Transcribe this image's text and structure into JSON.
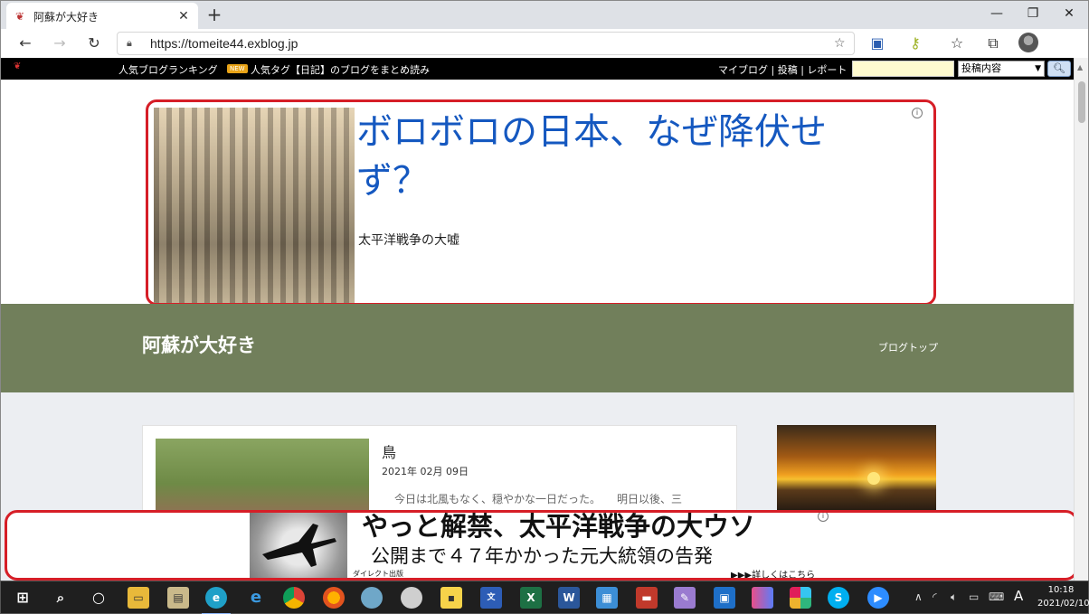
{
  "browser": {
    "tab_title": "阿蘇が大好き",
    "url": "https://tomeite44.exblog.jp"
  },
  "blogbar": {
    "ranking": "人気ブログランキング",
    "new_badge": "NEW",
    "tag_text": "人気タグ【日記】のブログをまとめ読み",
    "links": "マイブログ | 投稿 | レポート",
    "search_scope": "投稿内容"
  },
  "ad_top": {
    "headline": "ボロボロの日本、なぜ降伏せず？",
    "subtitle": "太平洋戦争の大嘘"
  },
  "blog_header": {
    "name": "阿蘇が大好き",
    "top_link": "ブログトップ"
  },
  "post": {
    "title": "鳥",
    "date": "2021年 02月 09日",
    "excerpt": "今日は北風もなく、穏やかな一日だった。　　明日以後、三"
  },
  "ad_bottom": {
    "headline": "やっと解禁、太平洋戦争の大ウソ",
    "subheadline": "公開まで４７年かかった元大統領の告発",
    "publisher": "ダイレクト出版",
    "more": "▶▶▶詳しくはこちら"
  },
  "taskbar": {
    "ime": "A",
    "time": "10:18",
    "date": "2021/02/10"
  },
  "colors": {
    "ad_border": "#d61e27",
    "header_bg": "#717f5b",
    "link_blue": "#1558c0"
  }
}
